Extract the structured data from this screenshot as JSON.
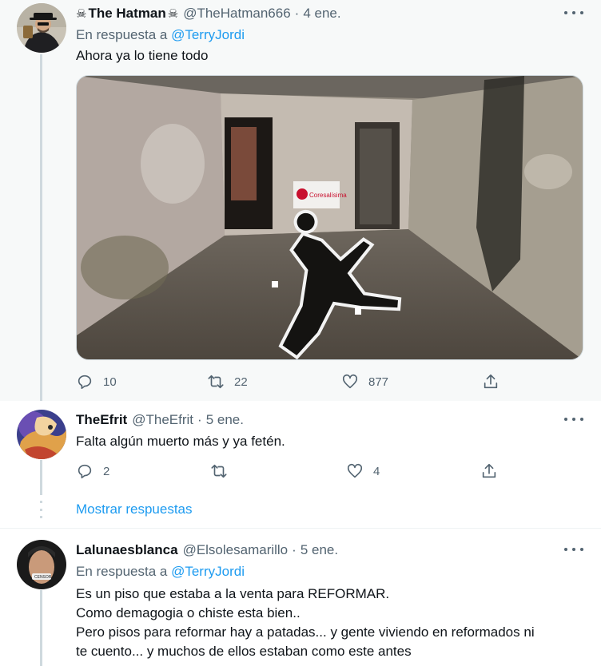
{
  "tweets": [
    {
      "name": "The Hatman",
      "skull_left": "☠",
      "skull_right": "☠",
      "handle": "@TheHatman666",
      "separator": "·",
      "time": "4 ene.",
      "reply_prefix": "En respuesta a",
      "reply_to": "@TerryJordi",
      "text": "Ahora ya lo tiene todo",
      "media_sign_text": "Coresalísima",
      "replies": "10",
      "retweets": "22",
      "likes": "877"
    },
    {
      "name": "TheEfrit",
      "handle": "@TheEfrit",
      "separator": "·",
      "time": "5 ene.",
      "text": "Falta algún muerto más y ya fetén.",
      "replies": "2",
      "retweets": "",
      "likes": "4",
      "show_replies": "Mostrar respuestas"
    },
    {
      "name": "Lalunaesblanca",
      "handle": "@Elsolesamarillo",
      "separator": "·",
      "time": "5 ene.",
      "reply_prefix": "En respuesta a",
      "reply_to": "@TerryJordi",
      "text_lines": [
        "Es un piso que estaba a la venta para REFORMAR.",
        "Como demagogia o chiste esta bien..",
        "Pero pisos para reformar hay a patadas... y gente viviendo en reformados ni",
        "te cuento... y muchos de ellos estaban como este antes"
      ]
    }
  ],
  "colors": {
    "link": "#1d9bf0",
    "secondary_text": "#536471",
    "highlight_bg": "#f7f9f9",
    "thread_line": "#cfd9de"
  },
  "icons": [
    "reply-icon",
    "retweet-icon",
    "like-icon",
    "share-icon",
    "more-icon"
  ]
}
